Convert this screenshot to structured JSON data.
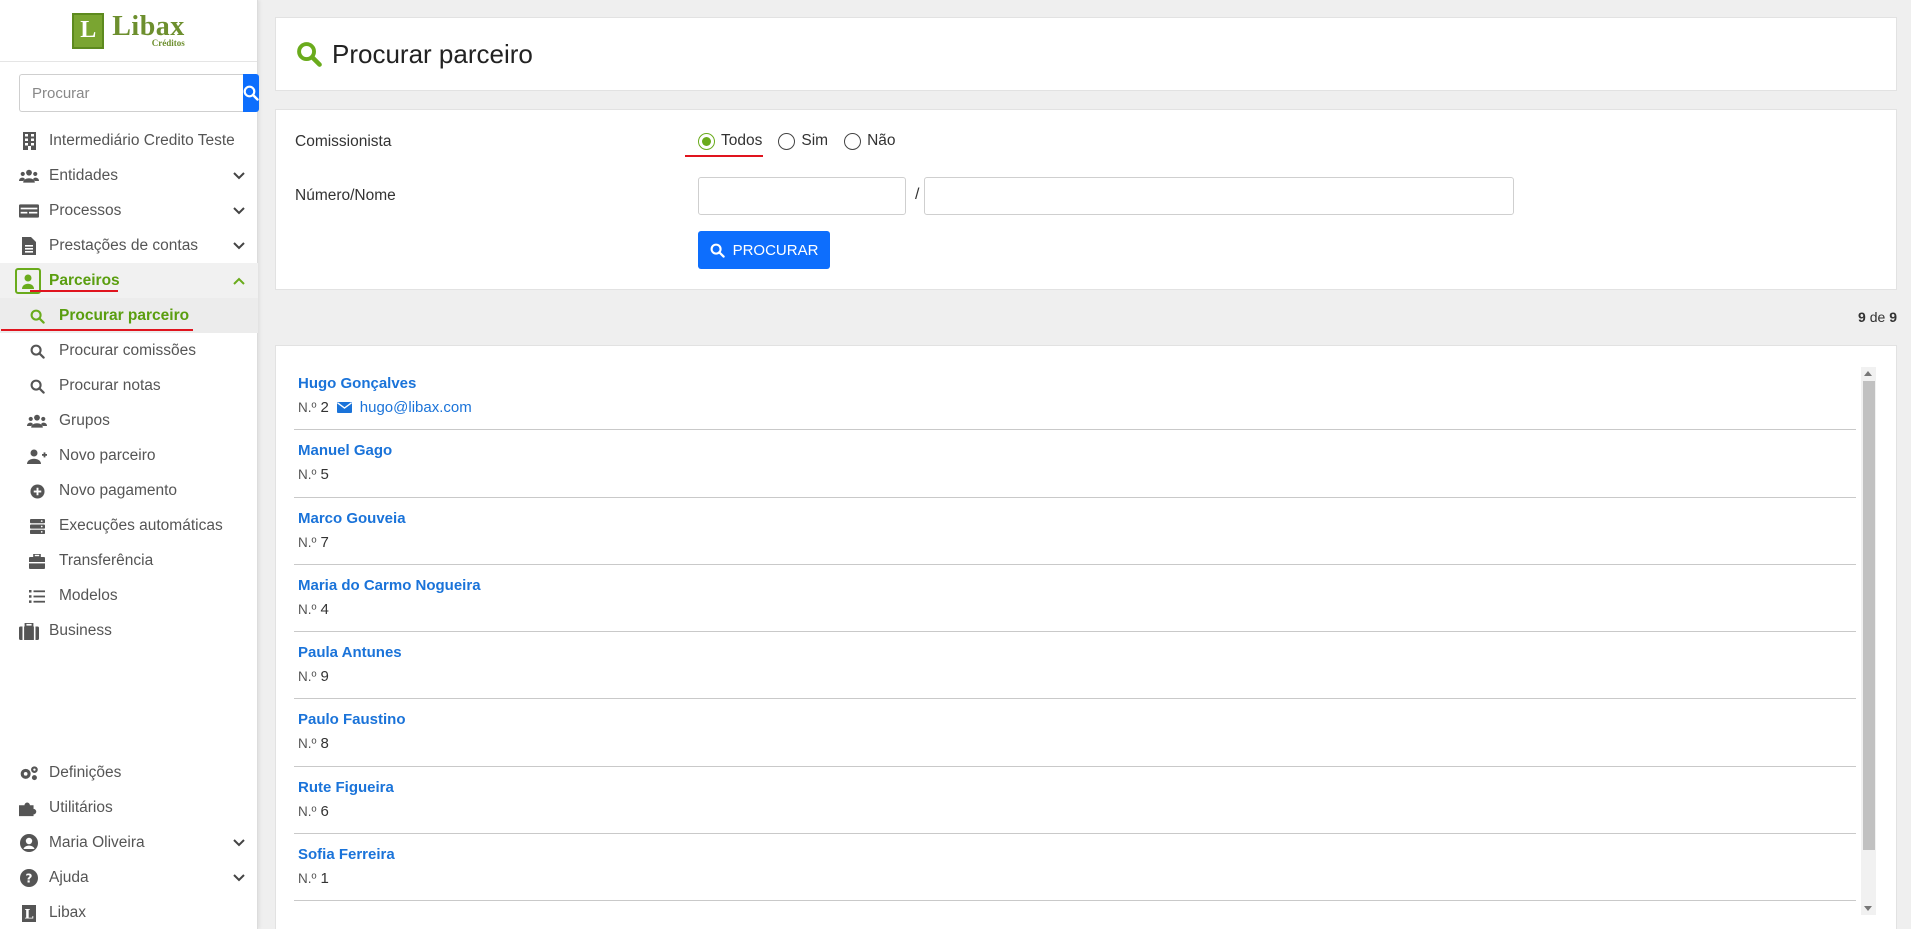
{
  "brand": {
    "name": "Libax",
    "sub": "Créditos",
    "mark": "L",
    "color": "#6d8f2e"
  },
  "search": {
    "placeholder": "Procurar"
  },
  "sidebar": {
    "items": [
      {
        "label": "Intermediário Credito Teste",
        "icon": "building-icon"
      },
      {
        "label": "Entidades",
        "icon": "users-icon",
        "expandable": true
      },
      {
        "label": "Processos",
        "icon": "card-icon",
        "expandable": true
      },
      {
        "label": "Prestações de contas",
        "icon": "document-icon",
        "expandable": true
      },
      {
        "label": "Parceiros",
        "icon": "partner-icon",
        "expandable": true,
        "expanded": true
      }
    ],
    "subitems": [
      {
        "label": "Procurar parceiro",
        "icon": "search-icon",
        "active": true
      },
      {
        "label": "Procurar comissões",
        "icon": "search-icon"
      },
      {
        "label": "Procurar notas",
        "icon": "search-icon"
      },
      {
        "label": "Grupos",
        "icon": "users-icon"
      },
      {
        "label": "Novo parceiro",
        "icon": "user-plus-icon"
      },
      {
        "label": "Novo pagamento",
        "icon": "plus-circle-icon"
      },
      {
        "label": "Execuções automáticas",
        "icon": "server-icon"
      },
      {
        "label": "Transferência",
        "icon": "toolbox-icon"
      },
      {
        "label": "Modelos",
        "icon": "list-icon"
      }
    ],
    "business": {
      "label": "Business",
      "icon": "briefcase-icon"
    },
    "bottom": [
      {
        "label": "Definições",
        "icon": "gears-icon"
      },
      {
        "label": "Utilitários",
        "icon": "puzzle-icon"
      },
      {
        "label": "Maria Oliveira",
        "icon": "user-circle-icon",
        "expandable": true
      },
      {
        "label": "Ajuda",
        "icon": "question-icon",
        "expandable": true
      },
      {
        "label": "Libax",
        "icon": "libax-icon"
      }
    ]
  },
  "page": {
    "title": "Procurar parceiro"
  },
  "form": {
    "comissionista_label": "Comissionista",
    "options": [
      "Todos",
      "Sim",
      "Não"
    ],
    "selected": "Todos",
    "numero_label": "Número/Nome",
    "separator": "/",
    "numero_value": "",
    "nome_value": "",
    "submit_label": "PROCURAR"
  },
  "results": {
    "shown": "9",
    "of_label": "de",
    "total": "9",
    "number_prefix": "N.º",
    "items": [
      {
        "name": "Hugo Gonçalves",
        "number": "2",
        "email": "hugo@libax.com"
      },
      {
        "name": "Manuel Gago",
        "number": "5"
      },
      {
        "name": "Marco Gouveia",
        "number": "7"
      },
      {
        "name": "Maria do Carmo Nogueira",
        "number": "4"
      },
      {
        "name": "Paula Antunes",
        "number": "9"
      },
      {
        "name": "Paulo Faustino",
        "number": "8"
      },
      {
        "name": "Rute Figueira",
        "number": "6"
      },
      {
        "name": "Sofia Ferreira",
        "number": "1"
      }
    ]
  },
  "colors": {
    "accent_green": "#6aab1c",
    "primary_blue": "#0d6efd",
    "link_blue": "#1a73d9",
    "highlight_red": "#e0141e"
  }
}
